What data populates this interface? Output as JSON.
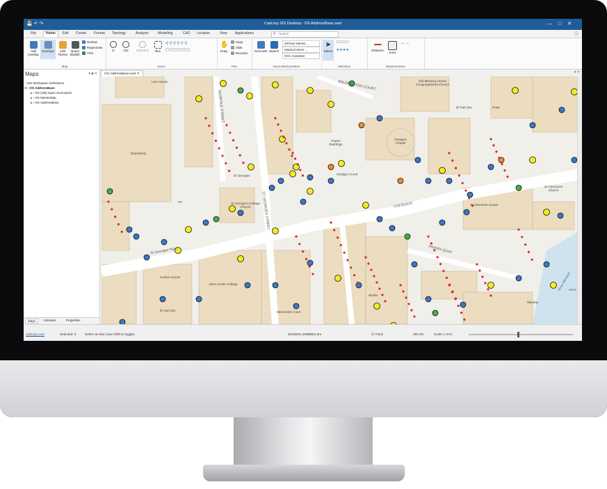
{
  "window": {
    "title": "Cadcorp SIS Desktop - OS AddressBase.swd",
    "qat_icons": [
      "save-icon",
      "undo-icon",
      "redo-icon"
    ]
  },
  "ribbon_tabs": [
    "File",
    "Home",
    "Edit",
    "Create",
    "Format",
    "Topology",
    "Analysis",
    "Modelling",
    "CAD",
    "Location",
    "View",
    "Applications"
  ],
  "active_tab": "Home",
  "search": {
    "placeholder": "Search"
  },
  "ribbon": {
    "map_group": {
      "label": "Map",
      "add_overlay": "Add Overlay",
      "overlays": "Overlays",
      "add_theme": "Add Theme",
      "query_builder": "Query Builder",
      "redraw": "Redraw",
      "regenerate": "Regenerate",
      "crs": "CRS"
    },
    "zoom_group": {
      "label": "Zoom",
      "in": "In",
      "out": "Out",
      "selection": "Selection",
      "box": "Box"
    },
    "pan_group": {
      "label": "Pan",
      "drag": "Drag",
      "snap": "Snap",
      "slide": "Slide",
      "recentre": "Recentre"
    },
    "gazetteer_group": {
      "label": "Geocode/Gazetteer",
      "geocode": "Geocode",
      "search": "Search",
      "options": [
        "GEOnet Names...",
        "National Street ...",
        "OGC Gazetteer"
      ]
    },
    "selection_group": {
      "label": "Selection",
      "select": "Select"
    },
    "measurement_group": {
      "label": "Measurement",
      "distance": "Distance",
      "area": "Area"
    }
  },
  "left_panel": {
    "title": "Maps",
    "tree": [
      "SIS Workspace Definitions",
      "OS AddressBase",
      "OS (GB) Open Zoomstack",
      "OS MasterMap",
      "OS AddressBase"
    ],
    "tabs": [
      "Maps",
      "Libraries",
      "Properties"
    ]
  },
  "document_tab": "OS AddressBase.swd",
  "map_labels": {
    "lion_house": "Lion House",
    "depository": "Depository",
    "ph": "PH",
    "st_georges": "St Georges",
    "st_georges_college": "St George's College Church",
    "st_georges_plain": "St Georges Plain",
    "colegate": "COLEGATE",
    "octagon_court": "Octagon Court",
    "octagon": "Octagon Chapel",
    "popes_buildings": "Popes Buildings",
    "balderston_court": "BALDERSTON COURT",
    "old_meeting_house": "Old Meeting House Congregational Church",
    "el_sub_sta": "El Sub Sta",
    "pods": "Pods",
    "st_clements_house": "St Clements House",
    "st_clements": "St Clement's Church",
    "friars_quay": "FRIARS QUAY",
    "jane_austin_college": "Jane Austin College",
    "merchants_court": "Merchants Court",
    "works": "Works",
    "coslon_house": "Coslon House",
    "el_sub_sta2": "El Sub Sta",
    "muspole_street": "MUSPOLE STREET",
    "st_georges_street": "ST GEORGES STREET",
    "river_wensum": "River Wensum",
    "mlw": "MLW",
    "slipway": "Slipway"
  },
  "status_bar": {
    "link": "cadcorp.com",
    "selected": "Selected: 0",
    "hint": "Select an item (use Shift to toggle)",
    "coords": "623203m,308985m,0m",
    "track": "Track",
    "scale_text": "301.9m",
    "scale": "Scale 1: 674"
  },
  "colors": {
    "title_bar": "#1f5c99",
    "building": "#ecdcc0",
    "road": "#ffffff",
    "water": "#cfe3ee",
    "pin_blue": "#3a78c9",
    "pin_yellow": "#f7ea1c",
    "pin_red": "#d42a2a",
    "pin_orange": "#f08a2a",
    "pin_green": "#41b04b"
  }
}
